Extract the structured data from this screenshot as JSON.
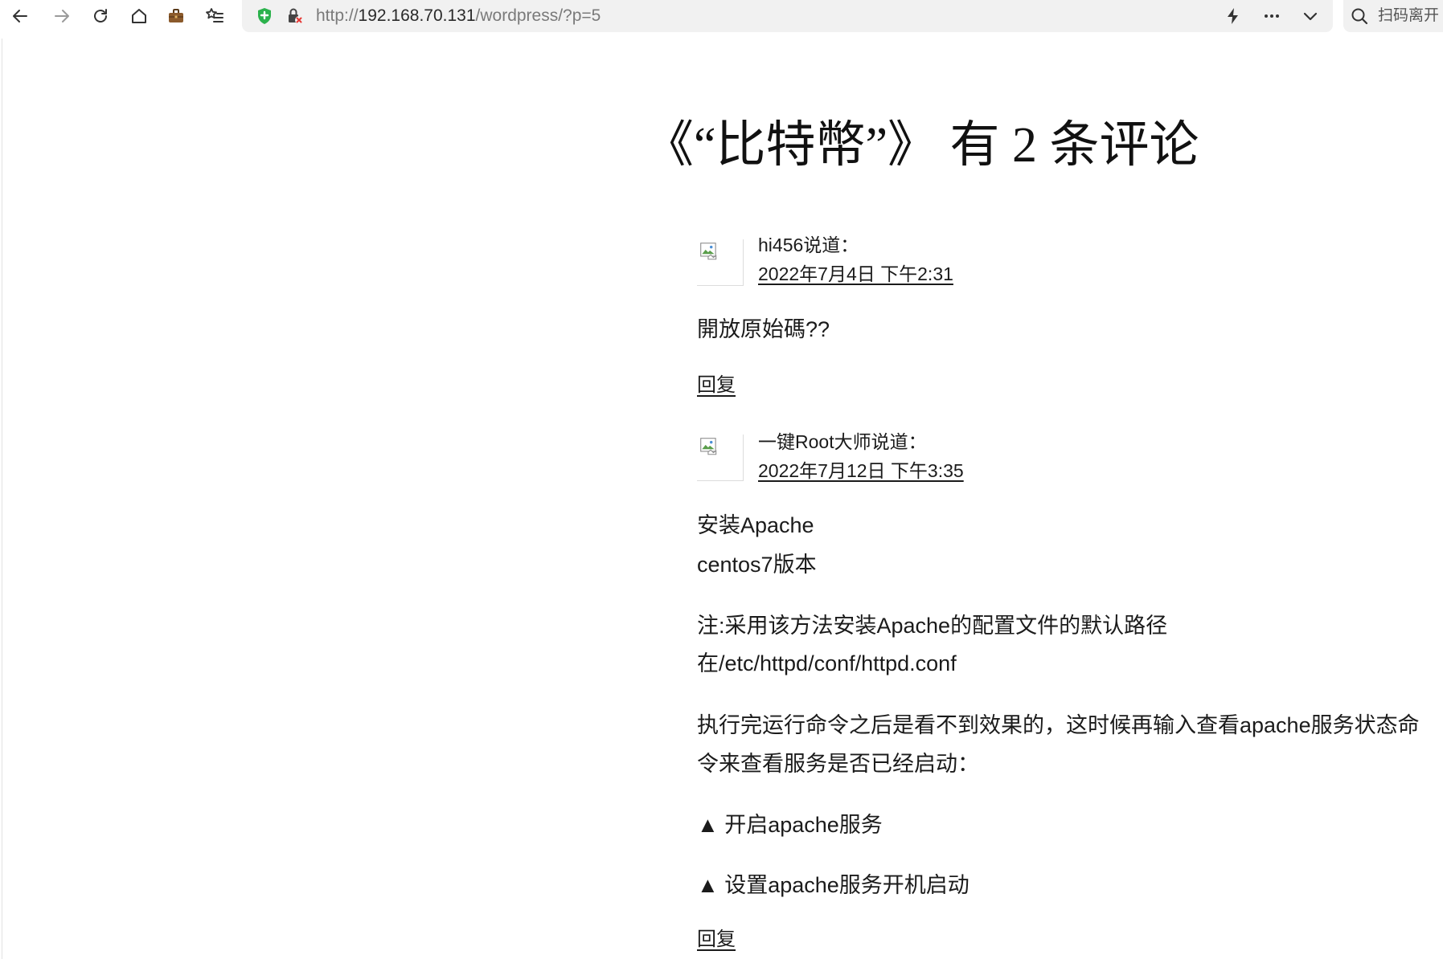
{
  "browser": {
    "toolbar_icons": {
      "back": "arrow-left-icon",
      "forward": "arrow-right-icon",
      "reload": "reload-icon",
      "home": "home-icon",
      "briefcase": "briefcase-icon",
      "favorites": "star-list-icon",
      "security": "shield-plus-icon",
      "connection": "lock-insecure-icon",
      "speed": "lightning-icon",
      "more": "more-dots-icon",
      "dropdown": "chevron-down-icon",
      "search": "search-icon",
      "avatar": "broken-image-icon"
    },
    "address": {
      "scheme": "http://",
      "host": "192.168.70.131",
      "path": "/wordpress/?p=5"
    },
    "search_box": {
      "text": "扫码离开"
    }
  },
  "colors": {
    "text": "#1b1b1b",
    "url_muted": "#7a7a7a",
    "shield_green": "#2bb24c",
    "insecure_red": "#e53935",
    "briefcase_brown": "#8b5a2b",
    "address_bg": "#f1f1f1"
  },
  "comments_section": {
    "title": "《“比特幣”》 有 2 条评论",
    "comments": [
      {
        "author": "hi456",
        "says": "说道：",
        "date": "2022年7月4日 下午2:31",
        "paragraphs": [
          [
            "開放原始碼??"
          ]
        ],
        "reply": "回复"
      },
      {
        "author": "一键Root大师",
        "says": "说道：",
        "date": "2022年7月12日 下午3:35",
        "paragraphs": [
          [
            "安装Apache",
            "centos7版本"
          ],
          [
            "注:采用该方法安装Apache的配置文件的默认路径",
            "在/etc/httpd/conf/httpd.conf"
          ],
          [
            "执行完运行命令之后是看不到效果的，这时候再输入查看apache服务状态命令来查看服务是否已经启动："
          ],
          [
            "▲ 开启apache服务"
          ],
          [
            "▲ 设置apache服务开机启动"
          ]
        ],
        "reply": "回复"
      }
    ]
  }
}
